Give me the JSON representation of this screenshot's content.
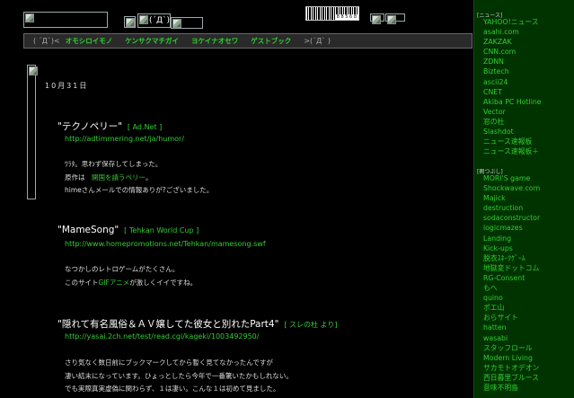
{
  "header": {
    "face": "(´Д`)",
    "counter_digits": "8 8 5 6 8"
  },
  "nav": {
    "face_left": "( ´Д`)<",
    "items": [
      "オモシロイモノ",
      "ケンサクマチガイ",
      "ヨケイナオセワ",
      "ゲストブック"
    ],
    "face_right": ">(´Д`   )"
  },
  "date": "10月31日",
  "entries": [
    {
      "title": "\"テクノペリー\"",
      "source_open": "[ ",
      "source": "Ad.Net",
      "source_close": " ]",
      "url": "http://adtimmering.net/ja/humor/",
      "lines": {
        "l1": "ﾜﾗﾀ。思わず保存してしまった。",
        "l2_pre": "原作は　",
        "l2_link": "開国を請うペリー",
        "l2_post": "。",
        "l3": "himeさんメールでの情報ありが?ございました。"
      }
    },
    {
      "title": "\"MameSong\"",
      "source_open": "[ ",
      "source": "Tehkan World Cup",
      "source_close": " ]",
      "url": "http://www.homepromotions.net/Tehkan/mamesong.swf",
      "lines": {
        "l1": "なつかしのレトロゲームがたくさん。",
        "l2_pre": "このサイト",
        "l2_link": "GIFアニメ",
        "l2_post": "が激しくイイですね。"
      }
    },
    {
      "title": "\"隠れて有名風俗＆ＡＶ嬢してた彼女と別れたPart4\"",
      "source_open": "[ ",
      "source": "スレの杜",
      "source_close": " より]",
      "url": "http://yasai.2ch.net/test/read.cgi/kageki/1003492950/",
      "lines": {
        "l1": "さり気なく数日前にブックマークしてから暫く見てなかったんですが",
        "l2": "凄い結末になっています。ひょっとしたら今年で一番驚いたかもしれない。",
        "l3": "でも実際真実虚偽に関わらず、１は凄い。こんな１は初めて見ました。"
      }
    }
  ],
  "sidebar": {
    "news_heading": "[ニュース]",
    "news": [
      "YAHOO!ニュース",
      "asahi.com",
      "ZAKZAK",
      "CNN.com",
      "ZDNN",
      "Biztech",
      "ascii24",
      "CNET",
      "Akiba PC Hotline",
      "Vector",
      "窓の杜",
      "Slashdot",
      "ニュース速報板",
      "ニュース速報板＋"
    ],
    "kill_heading": "[暇つぶし]",
    "kill": [
      "MORI'S game",
      "Shockwave.com",
      "Majick",
      "destruction",
      "sodaconstructor",
      "logicmazes",
      "Landing",
      "Kick-ups",
      "脱衣ｽﾈｰｸｹﾞｰﾑ",
      "地獄変ドットコム",
      "RG-Consent",
      "もへ",
      "quino",
      "ポエ山",
      "おらサイト",
      "hatten",
      "wasabi",
      "スタッフロール",
      "Modern Living",
      "サカモトオデオン",
      "西日暮里ブルース",
      "意味不明島"
    ]
  }
}
